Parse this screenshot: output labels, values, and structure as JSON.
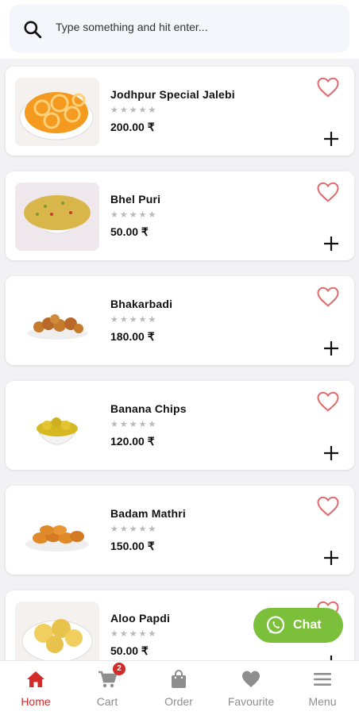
{
  "search": {
    "placeholder": "Type something and hit enter..."
  },
  "products": [
    {
      "name": "Jodhpur Special Jalebi",
      "price": "200.00 ₹",
      "rating_stars": "★★★★★"
    },
    {
      "name": "Bhel Puri",
      "price": "50.00 ₹",
      "rating_stars": "★★★★★"
    },
    {
      "name": "Bhakarbadi",
      "price": "180.00 ₹",
      "rating_stars": "★★★★★"
    },
    {
      "name": "Banana Chips",
      "price": "120.00 ₹",
      "rating_stars": "★★★★★"
    },
    {
      "name": "Badam Mathri",
      "price": "150.00 ₹",
      "rating_stars": "★★★★★"
    },
    {
      "name": "Aloo Papdi",
      "price": "50.00 ₹",
      "rating_stars": "★★★★★"
    }
  ],
  "chat": {
    "label": "Chat"
  },
  "nav": {
    "home": "Home",
    "cart": "Cart",
    "cart_count": "2",
    "order": "Order",
    "favourite": "Favourite",
    "menu": "Menu"
  },
  "colors": {
    "accent": "#d32a2a",
    "heart": "#e06b6b",
    "chat": "#7cbf3a",
    "inactive": "#8e8e8e"
  }
}
